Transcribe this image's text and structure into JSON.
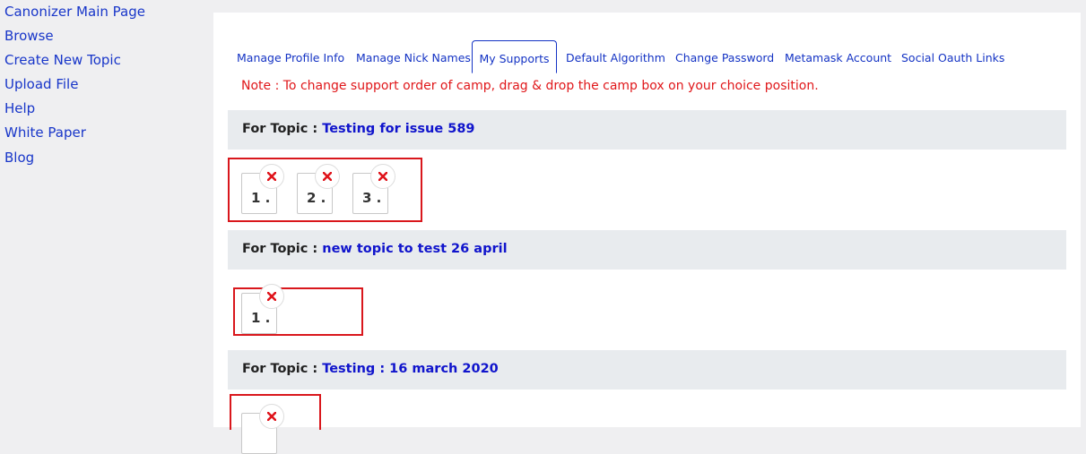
{
  "sidebar": {
    "items": [
      {
        "label": "Canonizer Main Page"
      },
      {
        "label": "Browse"
      },
      {
        "label": "Create New Topic"
      },
      {
        "label": "Upload File"
      },
      {
        "label": "Help"
      },
      {
        "label": "White Paper"
      },
      {
        "label": "Blog"
      }
    ]
  },
  "tabs": [
    {
      "label": "Manage Profile Info"
    },
    {
      "label": "Manage Nick Names"
    },
    {
      "label": "My Supports",
      "active": true
    },
    {
      "label": "Default Algorithm"
    },
    {
      "label": "Change Password"
    },
    {
      "label": "Metamask Account"
    },
    {
      "label": "Social Oauth Links"
    }
  ],
  "note": "Note : To change support order of camp, drag & drop the camp box on your choice position.",
  "topic_prefix": "For Topic : ",
  "topics": [
    {
      "name": "Testing for issue 589",
      "camps": [
        "1 .",
        "2 .",
        "3 ."
      ]
    },
    {
      "name": "new topic to test 26 april",
      "camps": [
        "1 ."
      ]
    },
    {
      "name": "Testing : 16 march 2020",
      "camps": [
        ""
      ]
    }
  ],
  "colors": {
    "link": "#1836c9",
    "note": "#e0171a",
    "topic_link": "#1014cc",
    "highlight_box": "#d9171c",
    "remove_icon": "#e0141b"
  }
}
